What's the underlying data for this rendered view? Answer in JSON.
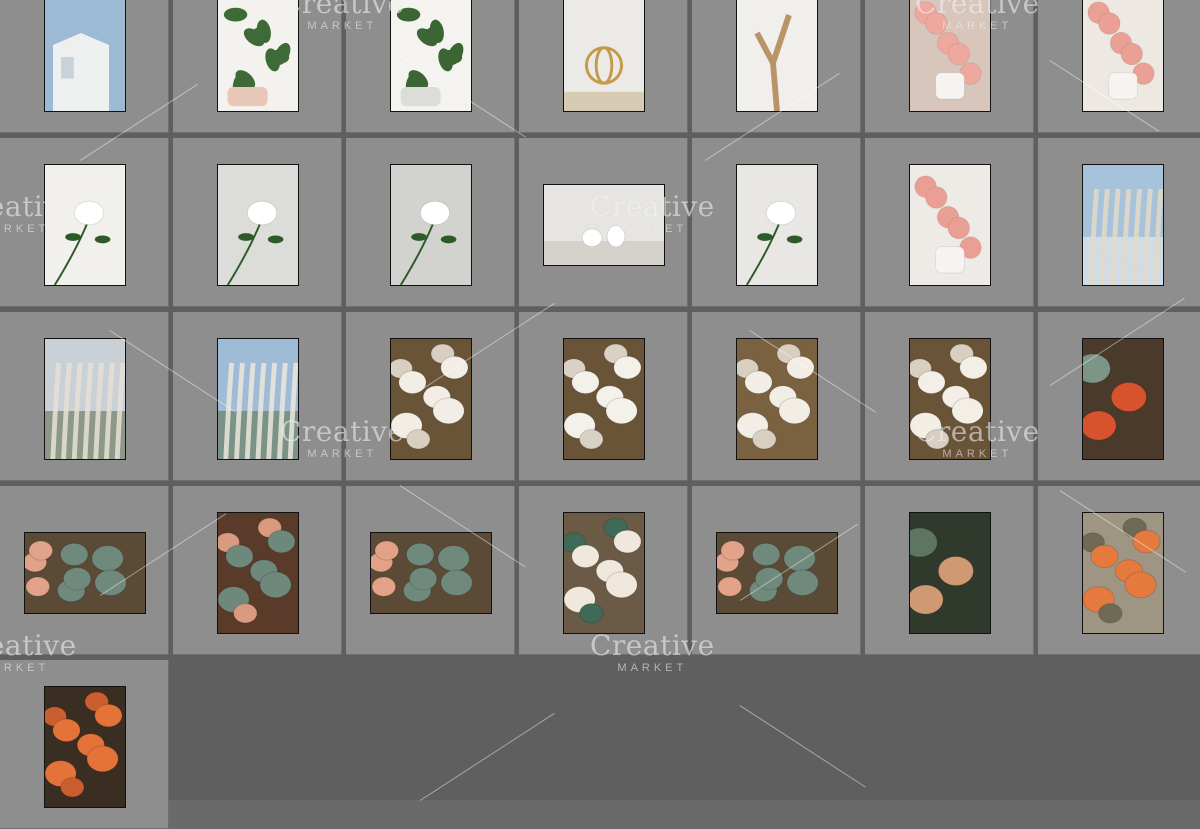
{
  "watermark": {
    "brand": "Creative",
    "sub": "MARKET"
  },
  "thumbnails": [
    {
      "subject": "white-house-sky",
      "orientation": "portrait",
      "palette": [
        "#9cbad4",
        "#eef0f0",
        "#c9d2d8"
      ]
    },
    {
      "subject": "green-plant-in-hand",
      "orientation": "portrait",
      "palette": [
        "#f4f2ee",
        "#3e6a37",
        "#e7c7b5"
      ]
    },
    {
      "subject": "green-plant-on-white",
      "orientation": "portrait",
      "palette": [
        "#f5f3f0",
        "#3b6634",
        "#dcdcd8"
      ]
    },
    {
      "subject": "gold-orb-decor",
      "orientation": "portrait",
      "palette": [
        "#eceae6",
        "#c49a4a",
        "#d8cbb4"
      ]
    },
    {
      "subject": "driftwood-branch",
      "orientation": "portrait",
      "palette": [
        "#f1efeb",
        "#b89467",
        "#e0d6c8"
      ]
    },
    {
      "subject": "pink-roses-vase",
      "orientation": "portrait",
      "palette": [
        "#d8c6bc",
        "#eea89d",
        "#f6f1ec"
      ]
    },
    {
      "subject": "pink-roses-table",
      "orientation": "portrait",
      "palette": [
        "#eee8e3",
        "#eaa095",
        "#d6cbc1"
      ]
    },
    {
      "subject": "magnolia-in-hand",
      "orientation": "portrait",
      "palette": [
        "#f2f0ec",
        "#ffffff",
        "#2e5a2a"
      ]
    },
    {
      "subject": "magnolia-single",
      "orientation": "portrait",
      "palette": [
        "#dcdcd8",
        "#ffffff",
        "#2e5a2a"
      ]
    },
    {
      "subject": "magnolia-bloom",
      "orientation": "portrait",
      "palette": [
        "#d2d3cf",
        "#ffffff",
        "#2e5a2a"
      ]
    },
    {
      "subject": "white-vases-shelf",
      "orientation": "landscape",
      "palette": [
        "#e7e5e1",
        "#ffffff",
        "#d5d2cc"
      ]
    },
    {
      "subject": "magnolia-vases",
      "orientation": "portrait",
      "palette": [
        "#e9e7e3",
        "#ffffff",
        "#2e5a2a"
      ]
    },
    {
      "subject": "pink-roses-leaves",
      "orientation": "portrait",
      "palette": [
        "#eeeae6",
        "#ea9f94",
        "#2f6b3c"
      ]
    },
    {
      "subject": "pampas-sky",
      "orientation": "portrait",
      "palette": [
        "#a7c3dc",
        "#e3d9c7",
        "#f3f2ef"
      ]
    },
    {
      "subject": "pampas-grass",
      "orientation": "portrait",
      "palette": [
        "#c9d1d6",
        "#e6e1d6",
        "#5a6c48"
      ]
    },
    {
      "subject": "pampas-grass-sky",
      "orientation": "portrait",
      "palette": [
        "#9fbcd6",
        "#ece6da",
        "#5d7047"
      ]
    },
    {
      "subject": "white-pumpkins",
      "orientation": "portrait",
      "palette": [
        "#6a5438",
        "#f2eee6",
        "#d8cfc0"
      ]
    },
    {
      "subject": "white-pumpkins-close",
      "orientation": "portrait",
      "palette": [
        "#6a5438",
        "#f4f1ea",
        "#d9d1c3"
      ]
    },
    {
      "subject": "white-pumpkins-hay",
      "orientation": "portrait",
      "palette": [
        "#7a6140",
        "#f2eee6",
        "#d8cfc0"
      ]
    },
    {
      "subject": "white-pumpkins-pile",
      "orientation": "portrait",
      "palette": [
        "#6a5438",
        "#f3efe7",
        "#d8cfc0"
      ]
    },
    {
      "subject": "pumpkin-stack",
      "orientation": "portrait",
      "palette": [
        "#4a3a2a",
        "#d9522e",
        "#7d9587"
      ]
    },
    {
      "subject": "green-pumpkins",
      "orientation": "landscape",
      "palette": [
        "#5b4a36",
        "#6f8a7d",
        "#e0a389"
      ]
    },
    {
      "subject": "green-pumpkins-crate",
      "orientation": "portrait",
      "palette": [
        "#5a3b29",
        "#6e887b",
        "#d99a80"
      ]
    },
    {
      "subject": "green-pumpkins-row",
      "orientation": "landscape",
      "palette": [
        "#5b4a36",
        "#6f8a7d",
        "#e3a287"
      ]
    },
    {
      "subject": "pumpkin-wagon",
      "orientation": "portrait",
      "palette": [
        "#6a5a46",
        "#f0e8dc",
        "#3f6a58"
      ]
    },
    {
      "subject": "green-pumpkins-group",
      "orientation": "landscape",
      "palette": [
        "#5b4a36",
        "#6f8a7d",
        "#e2a388"
      ]
    },
    {
      "subject": "tan-pumpkin",
      "orientation": "portrait",
      "palette": [
        "#2f3a2d",
        "#cf9a72",
        "#5d7562"
      ]
    },
    {
      "subject": "orange-pumpkins-grass",
      "orientation": "portrait",
      "palette": [
        "#9e9683",
        "#e57a3e",
        "#6f6a56"
      ]
    },
    {
      "subject": "orange-pumpkins",
      "orientation": "portrait",
      "palette": [
        "#3a2e22",
        "#e4733a",
        "#cb5e2e"
      ]
    }
  ]
}
